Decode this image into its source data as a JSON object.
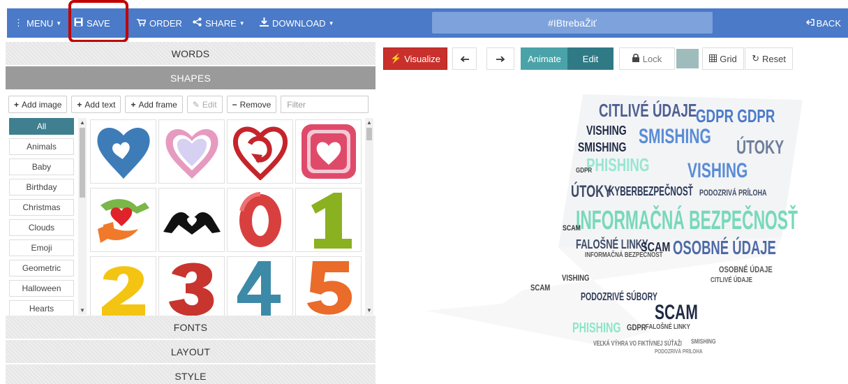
{
  "topbar": {
    "menu": "MENU",
    "save": "SAVE",
    "order": "ORDER",
    "share": "SHARE",
    "download": "DOWNLOAD",
    "title": "#IBtrebaŽiť",
    "back": "BACK"
  },
  "left": {
    "words_label": "WORDS",
    "shapes_label": "SHAPES",
    "fonts_label": "FONTS",
    "layout_label": "LAYOUT",
    "style_label": "STYLE",
    "toolbar": {
      "add_image": "Add image",
      "add_text": "Add text",
      "add_frame": "Add frame",
      "edit": "Edit",
      "remove": "Remove",
      "filter_placeholder": "Filter"
    },
    "categories": [
      "All",
      "Animals",
      "Baby",
      "Birthday",
      "Christmas",
      "Clouds",
      "Emoji",
      "Geometric",
      "Halloween",
      "Hearts"
    ],
    "shape_tiles": [
      "blue-heart",
      "pink-heart",
      "red-heart-arrow",
      "framed-heart",
      "hands-heart",
      "hands-heart-silhouette",
      "digit-0",
      "digit-1",
      "digit-2",
      "digit-3",
      "digit-4",
      "digit-5"
    ]
  },
  "right": {
    "visualize": "Visualize",
    "animate": "Animate",
    "edit": "Edit",
    "lock": "Lock",
    "grid": "Grid",
    "reset": "Reset",
    "swatch_color": "#9fbcbd"
  },
  "cloud_words": {
    "w1": "CITLIVÉ ÚDAJE",
    "w2": "GDPR GDPR",
    "w3": "VISHING",
    "w4": "SMISHING",
    "w5": "SMISHING",
    "w6": "PHISHING",
    "w7": "VISHING",
    "w8": "ÚTOKY",
    "w9": "ÚTOKY",
    "w10": "KYBERBEZPEČNOSŤ",
    "w11": "INFORMAČNÁ BEZPEČNOSŤ",
    "w12": "FALOŠNÉ LINKY",
    "w13": "SCAM",
    "w14": "OSOBNÉ ÚDAJE",
    "w15": "PODOZRIVÉ SÚBORY",
    "w16": "SCAM",
    "w17": "PHISHING",
    "w18": "GDPR",
    "w19": "PODOZRIVÁ PRÍLOHA",
    "w20": "INFORMAČNÁ BEZPEČNOSŤ",
    "w21": "SCAM",
    "w22": "OSOBNÉ ÚDAJE",
    "w23": "CITLIVÉ ÚDAJE",
    "w24": "FALOŠNÉ LINKY",
    "w25": "VISHING",
    "w26": "SCAM",
    "w27": "GDPR",
    "w28": "VEĽKÁ VÝHRA VO FIKTÍVNEJ SÚŤAŽI",
    "w29": "SMISHING",
    "w30": "PODOZRIVÁ PRÍLOHA"
  }
}
